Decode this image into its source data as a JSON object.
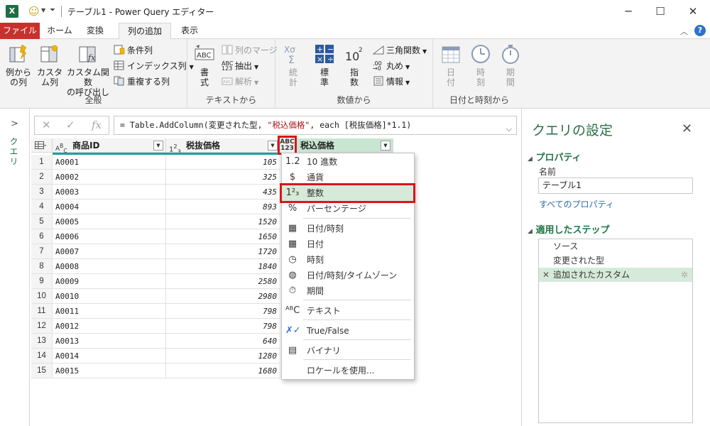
{
  "window": {
    "title": "テーブル1 - Power Query エディター",
    "app_icon": "X"
  },
  "tabs": {
    "file": "ファイル",
    "home": "ホーム",
    "transform": "変換",
    "add_column": "列の追加",
    "view": "表示"
  },
  "ribbon": {
    "general": {
      "label": "全般",
      "col_from_examples": "例から\nの列",
      "custom_column": "カスタ\nム列",
      "invoke_custom_function": "カスタム関数\nの呼び出し",
      "conditional_column": "条件列",
      "index_column": "インデックス列",
      "duplicate_column": "重複する列"
    },
    "from_text": {
      "label": "テキストから",
      "format": "書\n式",
      "merge_columns": "列のマージ",
      "extract": "抽出",
      "parse": "解析"
    },
    "from_number": {
      "label": "数値から",
      "statistics": "統\n計",
      "standard": "標\n準",
      "scientific": "指\n数",
      "trigonometry": "三角関数",
      "rounding": "丸め",
      "information": "情報"
    },
    "from_date_time": {
      "label": "日付と時刻から",
      "date": "日\n付",
      "time": "時\n刻",
      "duration": "期\n間"
    }
  },
  "query_pane": {
    "label": "クエリ"
  },
  "formula": {
    "prefix": "= Table.AddColumn(変更された型, ",
    "string": "\"税込価格\"",
    "suffix": ", each [税抜価格]*1.1)"
  },
  "grid": {
    "columns": [
      {
        "type_label": "ABC",
        "name": "商品ID"
      },
      {
        "type_label": "123",
        "name": "税抜価格"
      },
      {
        "type_label": "ABC123",
        "name": "税込価格"
      }
    ],
    "rows": [
      {
        "n": "1",
        "id": "A0001",
        "price": "105"
      },
      {
        "n": "2",
        "id": "A0002",
        "price": "325"
      },
      {
        "n": "3",
        "id": "A0003",
        "price": "435"
      },
      {
        "n": "4",
        "id": "A0004",
        "price": "893"
      },
      {
        "n": "5",
        "id": "A0005",
        "price": "1520"
      },
      {
        "n": "6",
        "id": "A0006",
        "price": "1650"
      },
      {
        "n": "7",
        "id": "A0007",
        "price": "1720"
      },
      {
        "n": "8",
        "id": "A0008",
        "price": "1840"
      },
      {
        "n": "9",
        "id": "A0009",
        "price": "2580"
      },
      {
        "n": "10",
        "id": "A0010",
        "price": "2980"
      },
      {
        "n": "11",
        "id": "A0011",
        "price": "798"
      },
      {
        "n": "12",
        "id": "A0012",
        "price": "798"
      },
      {
        "n": "13",
        "id": "A0013",
        "price": "640"
      },
      {
        "n": "14",
        "id": "A0014",
        "price": "1280"
      },
      {
        "n": "15",
        "id": "A0015",
        "price": "1680"
      }
    ]
  },
  "type_menu": {
    "items": [
      {
        "icon": "1.2",
        "label": "10 進数"
      },
      {
        "icon": "$",
        "label": "通貨"
      },
      {
        "icon": "123",
        "label": "整数"
      },
      {
        "icon": "%",
        "label": "パーセンテージ"
      },
      {
        "icon": "datetime-icon",
        "label": "日付/時刻"
      },
      {
        "icon": "date-icon",
        "label": "日付"
      },
      {
        "icon": "time-icon",
        "label": "時刻"
      },
      {
        "icon": "timezone-icon",
        "label": "日付/時刻/タイムゾーン"
      },
      {
        "icon": "duration-icon",
        "label": "期間"
      },
      {
        "icon": "text-icon",
        "label": "テキスト"
      },
      {
        "icon": "boolean-icon",
        "label": "True/False"
      },
      {
        "icon": "binary-icon",
        "label": "バイナリ"
      },
      {
        "icon": "",
        "label": "ロケールを使用..."
      }
    ]
  },
  "settings": {
    "title": "クエリの設定",
    "properties_header": "プロパティ",
    "name_label": "名前",
    "name_value": "テーブル1",
    "all_properties_link": "すべてのプロパティ",
    "applied_steps_header": "適用したステップ",
    "steps": [
      "ソース",
      "変更された型",
      "追加されたカスタム"
    ]
  },
  "colors": {
    "accent_green": "#217346",
    "file_tab_red": "#c9302c",
    "highlight_red": "#d8161b",
    "selection_green": "#d6ead9",
    "teal_bar": "#21a09b"
  }
}
